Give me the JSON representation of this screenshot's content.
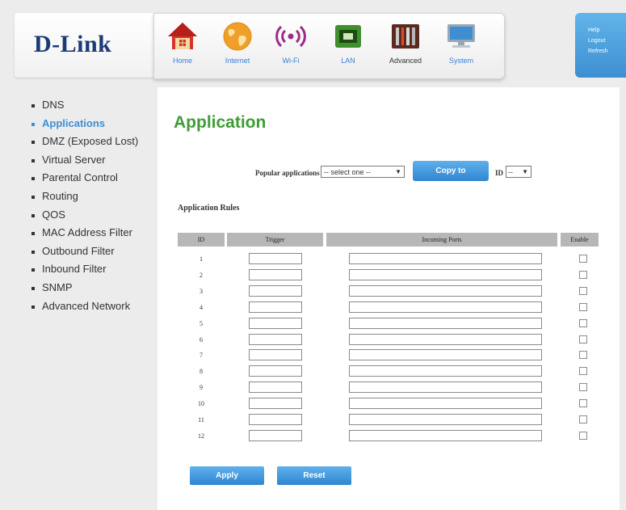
{
  "brand": {
    "logo_text": "D-Link"
  },
  "nav": {
    "items": [
      {
        "label": "Home",
        "icon": "home-icon",
        "active": false
      },
      {
        "label": "Internet",
        "icon": "globe-icon",
        "active": false
      },
      {
        "label": "Wi-Fi",
        "icon": "wifi-icon",
        "active": false
      },
      {
        "label": "LAN",
        "icon": "lan-port-icon",
        "active": false
      },
      {
        "label": "Advanced",
        "icon": "tools-icon",
        "active": true
      },
      {
        "label": "System",
        "icon": "computer-icon",
        "active": false
      }
    ]
  },
  "help_links": [
    "Help",
    "Logout",
    "Refresh"
  ],
  "sidebar": {
    "items": [
      {
        "label": "DNS",
        "active": false
      },
      {
        "label": "Applications",
        "active": true
      },
      {
        "label": "DMZ (Exposed Lost)",
        "active": false
      },
      {
        "label": "Virtual Server",
        "active": false
      },
      {
        "label": "Parental Control",
        "active": false
      },
      {
        "label": "Routing",
        "active": false
      },
      {
        "label": "QOS",
        "active": false
      },
      {
        "label": "MAC Address Filter",
        "active": false
      },
      {
        "label": "Outbound Filter",
        "active": false
      },
      {
        "label": "Inbound Filter",
        "active": false
      },
      {
        "label": "SNMP",
        "active": false
      },
      {
        "label": "Advanced Network",
        "active": false
      }
    ]
  },
  "main": {
    "title": "Application",
    "popular_label": "Popular applications",
    "popular_select_value": "-- select one --",
    "copy_button": "Copy to",
    "id_label": "ID",
    "id_select_value": "--",
    "rules_title": "Application Rules",
    "table": {
      "headers": {
        "id": "ID",
        "trigger": "Trigger",
        "ports": "Incoming Ports",
        "enable": "Enable"
      },
      "rows": [
        "1",
        "2",
        "3",
        "4",
        "5",
        "6",
        "7",
        "8",
        "9",
        "10",
        "11",
        "12"
      ]
    },
    "apply_button": "Apply",
    "reset_button": "Reset"
  },
  "colors": {
    "accent_blue": "#3d8fd1",
    "title_green": "#3f9c35",
    "logo_navy": "#1a3a78"
  }
}
